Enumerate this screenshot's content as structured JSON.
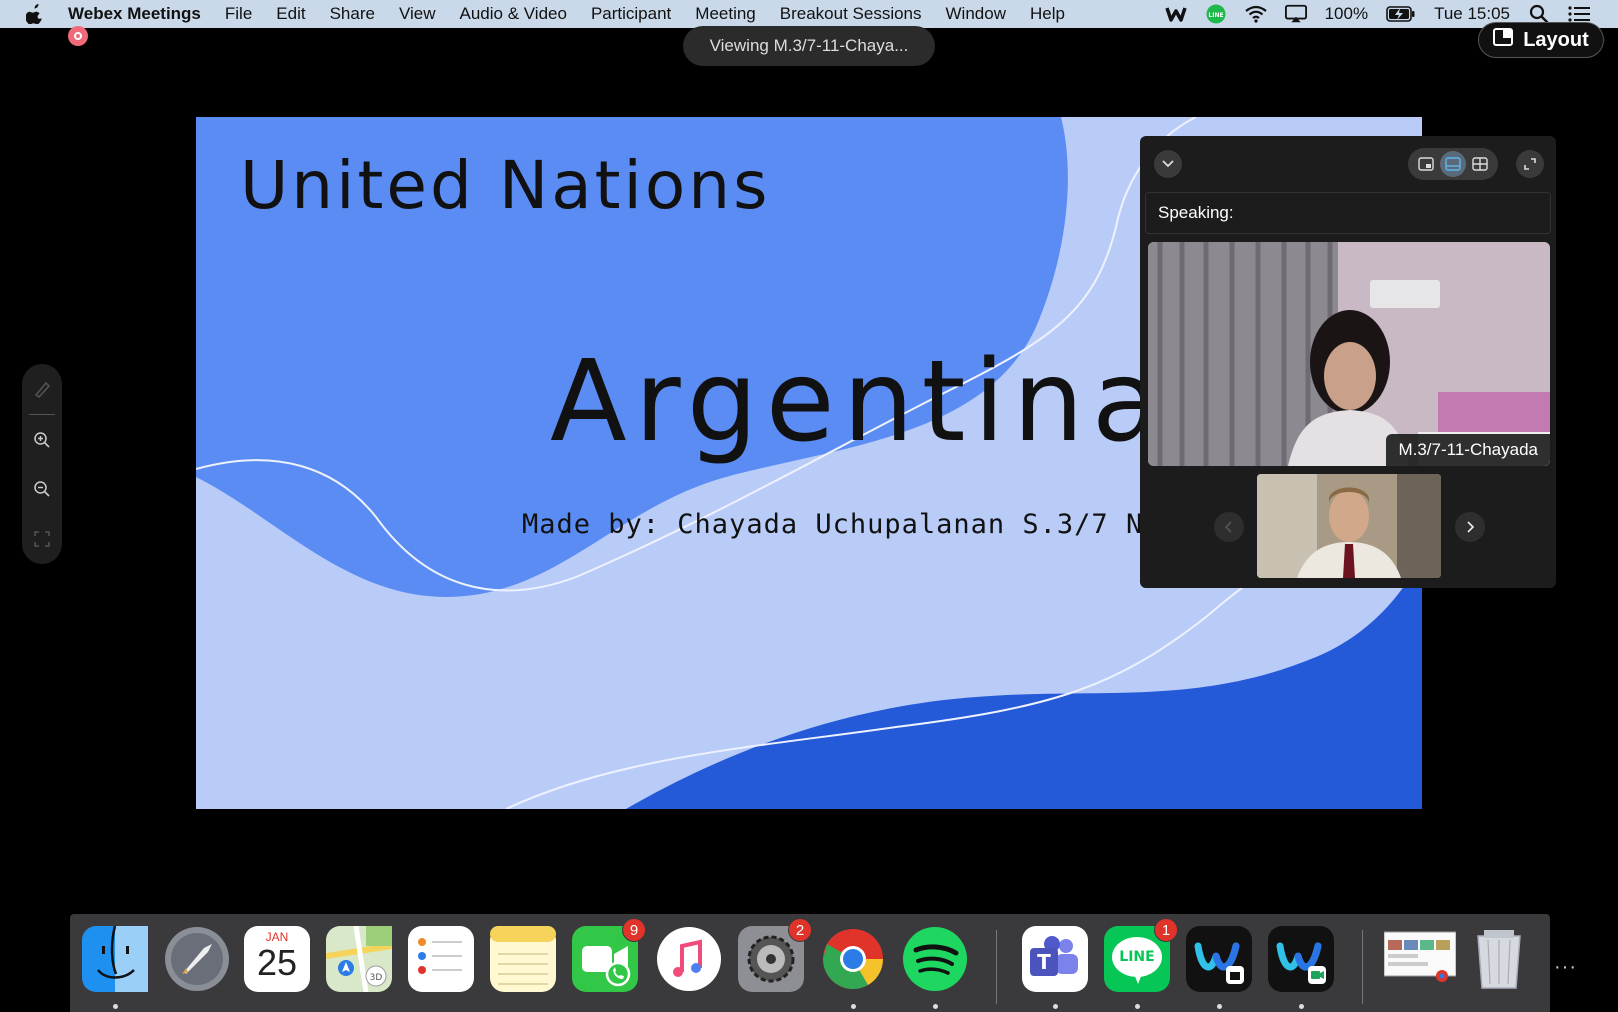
{
  "menubar": {
    "app_name": "Webex Meetings",
    "items": [
      "File",
      "Edit",
      "Share",
      "View",
      "Audio & Video",
      "Participant",
      "Meeting",
      "Breakout Sessions",
      "Window",
      "Help"
    ],
    "battery": "100%",
    "clock": "Tue 15:05"
  },
  "viewing_label": "Viewing M.3/7-11-Chaya...",
  "layout_label": "Layout",
  "slide": {
    "title": "United Nations",
    "heading": "Argentina",
    "credit": "Made by: Chayada Uchupalanan S.3/7 No.11"
  },
  "video_panel": {
    "speaking_label": "Speaking:",
    "main_participant": "M.3/7-11-Chayada"
  },
  "dock": {
    "calendar_month": "JAN",
    "calendar_day": "25",
    "facetime_badge": "9",
    "settings_badge": "2",
    "line_badge": "1",
    "line_label": "LINE"
  },
  "colors": {
    "menubar": "#c9d9ea",
    "slide_light": "#b9ccf8",
    "slide_mid": "#5a8cf4",
    "slide_dark": "#2459d8",
    "badge": "#e0342b"
  }
}
